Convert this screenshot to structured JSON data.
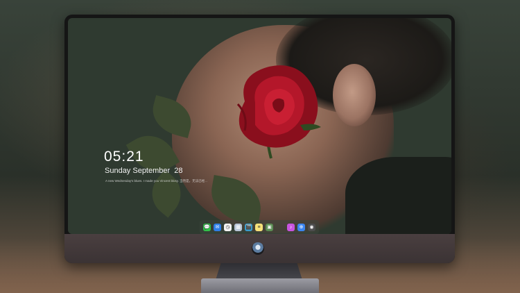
{
  "lock_screen": {
    "time": "05:21",
    "date": "Sunday September  28",
    "quote": "A new Wednesday's blues. I made you Vincent blosy. 当然是，无法已经..."
  },
  "dock": {
    "apps": [
      {
        "name": "messages-icon",
        "glyph": "💬",
        "color": "#33c24a"
      },
      {
        "name": "mail-icon",
        "glyph": "✉",
        "color": "#2f7fe8"
      },
      {
        "name": "clock-icon",
        "glyph": "◷",
        "color": "#f5f5f5"
      },
      {
        "name": "preview-icon",
        "glyph": "▦",
        "color": "#b9c6d8"
      },
      {
        "name": "clapper-icon",
        "glyph": "🎬",
        "color": "#3a9ccc"
      },
      {
        "name": "notes-icon",
        "glyph": "≡",
        "color": "#f7e27a"
      },
      {
        "name": "photo-icon",
        "glyph": "▣",
        "color": "#5b8d54"
      },
      {
        "name": "music-icon",
        "glyph": "♪",
        "color": "#c855e0"
      },
      {
        "name": "safari-icon",
        "glyph": "⊕",
        "color": "#3a86f0"
      },
      {
        "name": "camera-icon",
        "glyph": "◉",
        "color": "#4d4d4d"
      }
    ]
  },
  "colors": {
    "rose": "#b4172a",
    "leaf": "#3d4a30"
  }
}
